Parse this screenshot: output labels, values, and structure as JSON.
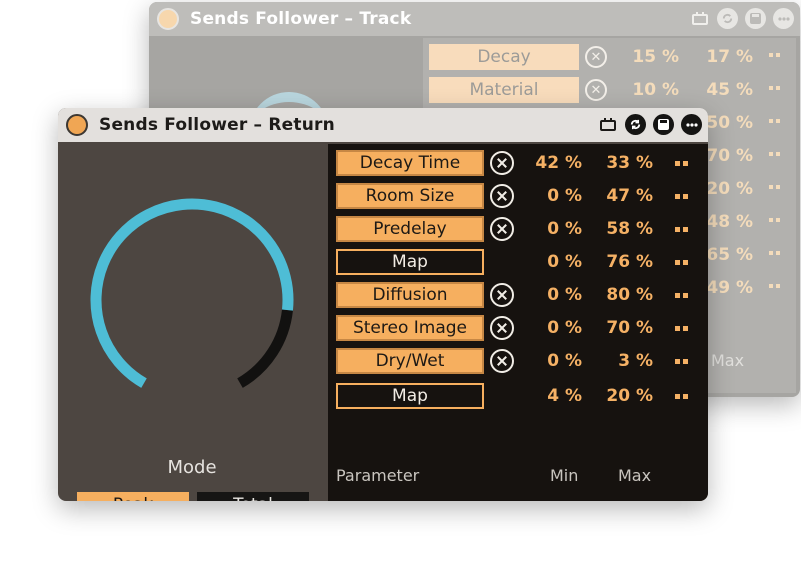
{
  "track_window": {
    "title": "Sends Follower – Track",
    "rows": [
      {
        "label": "Decay",
        "min": "15 %",
        "max": "17 %"
      },
      {
        "label": "Material",
        "min": "10 %",
        "max": "45 %"
      },
      {
        "label": "",
        "min": "",
        "max": "50 %"
      },
      {
        "label": "",
        "min": "",
        "max": "70 %"
      },
      {
        "label": "",
        "min": "",
        "max": "20 %"
      },
      {
        "label": "",
        "min": "",
        "max": "48 %"
      },
      {
        "label": "",
        "min": "",
        "max": "65 %"
      },
      {
        "label": "",
        "min": "",
        "max": "49 %"
      }
    ],
    "max_header": "Max"
  },
  "return_window": {
    "title": "Sends Follower – Return",
    "mode_label": "Mode",
    "mode_options": [
      "Peak",
      "Total"
    ],
    "mode_selected": "Peak",
    "knob_level": 0.82,
    "params": [
      {
        "label": "Decay Time",
        "min": "42 %",
        "max": "33 %",
        "mapped": true
      },
      {
        "label": "Room Size",
        "min": "0 %",
        "max": "47 %",
        "mapped": true
      },
      {
        "label": "Predelay",
        "min": "0 %",
        "max": "58 %",
        "mapped": true
      },
      {
        "label": "Map",
        "min": "0 %",
        "max": "76 %",
        "mapped": false
      },
      {
        "label": "Diffusion",
        "min": "0 %",
        "max": "80 %",
        "mapped": true
      },
      {
        "label": "Stereo Image",
        "min": "0 %",
        "max": "70 %",
        "mapped": true
      },
      {
        "label": "Dry/Wet",
        "min": "0 %",
        "max": "3 %",
        "mapped": true
      },
      {
        "label": "Map",
        "min": "4 %",
        "max": "20 %",
        "mapped": false
      }
    ],
    "headers": {
      "parameter": "Parameter",
      "min": "Min",
      "max": "Max"
    }
  },
  "icons": {
    "titlebar_tools": [
      "device-icon",
      "sync-icon",
      "save-icon",
      "more-icon"
    ],
    "remove": "remove-icon",
    "row_menu": "row-menu-icon"
  },
  "colors": {
    "accent": "#f6af5f",
    "knob_arc": "#4ebdd6",
    "panel": "#16120f",
    "window_body": "#4d4641"
  }
}
